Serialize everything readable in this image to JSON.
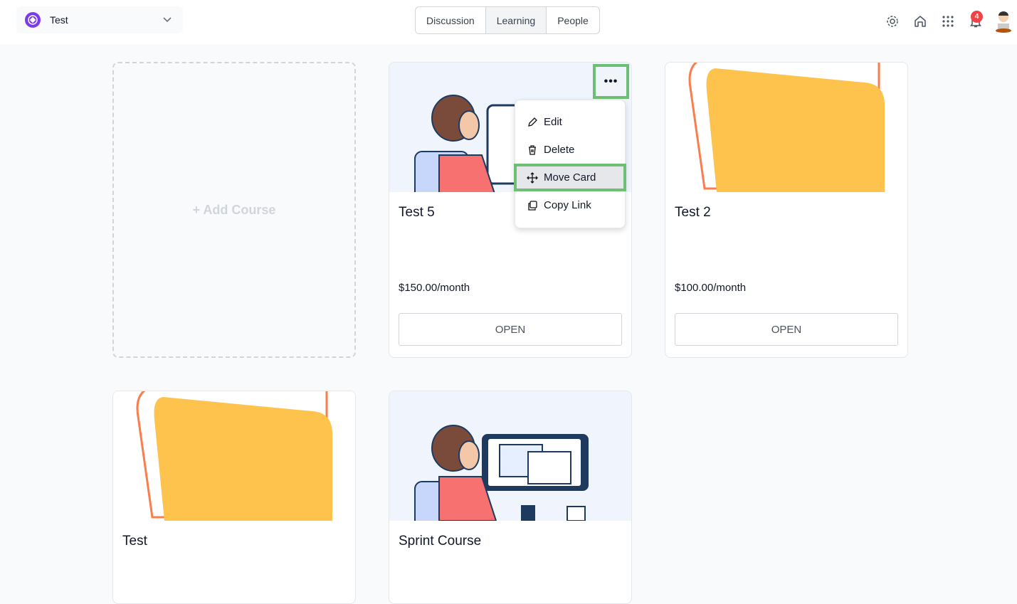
{
  "header": {
    "workspace": "Test",
    "tabs": [
      {
        "label": "Discussion",
        "active": false
      },
      {
        "label": "Learning",
        "active": true
      },
      {
        "label": "People",
        "active": false
      }
    ],
    "notification_count": "4",
    "icons": [
      "gear-icon",
      "home-icon",
      "apps-grid-icon",
      "bell-icon",
      "avatar"
    ]
  },
  "add_course": "+ Add Course",
  "cards": [
    {
      "title": "Test 5",
      "price": "$150.00",
      "period": "/month",
      "open": "OPEN",
      "image": "person-at-computer"
    },
    {
      "title": "Test 2",
      "price": "$100.00",
      "period": "/month",
      "open": "OPEN",
      "image": "yellow-shape"
    },
    {
      "title": "Test",
      "image": "yellow-shape"
    },
    {
      "title": "Sprint Course",
      "image": "person-at-computer"
    }
  ],
  "menu": {
    "items": [
      "Edit",
      "Delete",
      "Move Card",
      "Copy Link"
    ],
    "highlighted": "Move Card"
  },
  "colors": {
    "highlight": "#6dbf73",
    "brand": "#7c3aed",
    "badge": "#ef4444"
  }
}
